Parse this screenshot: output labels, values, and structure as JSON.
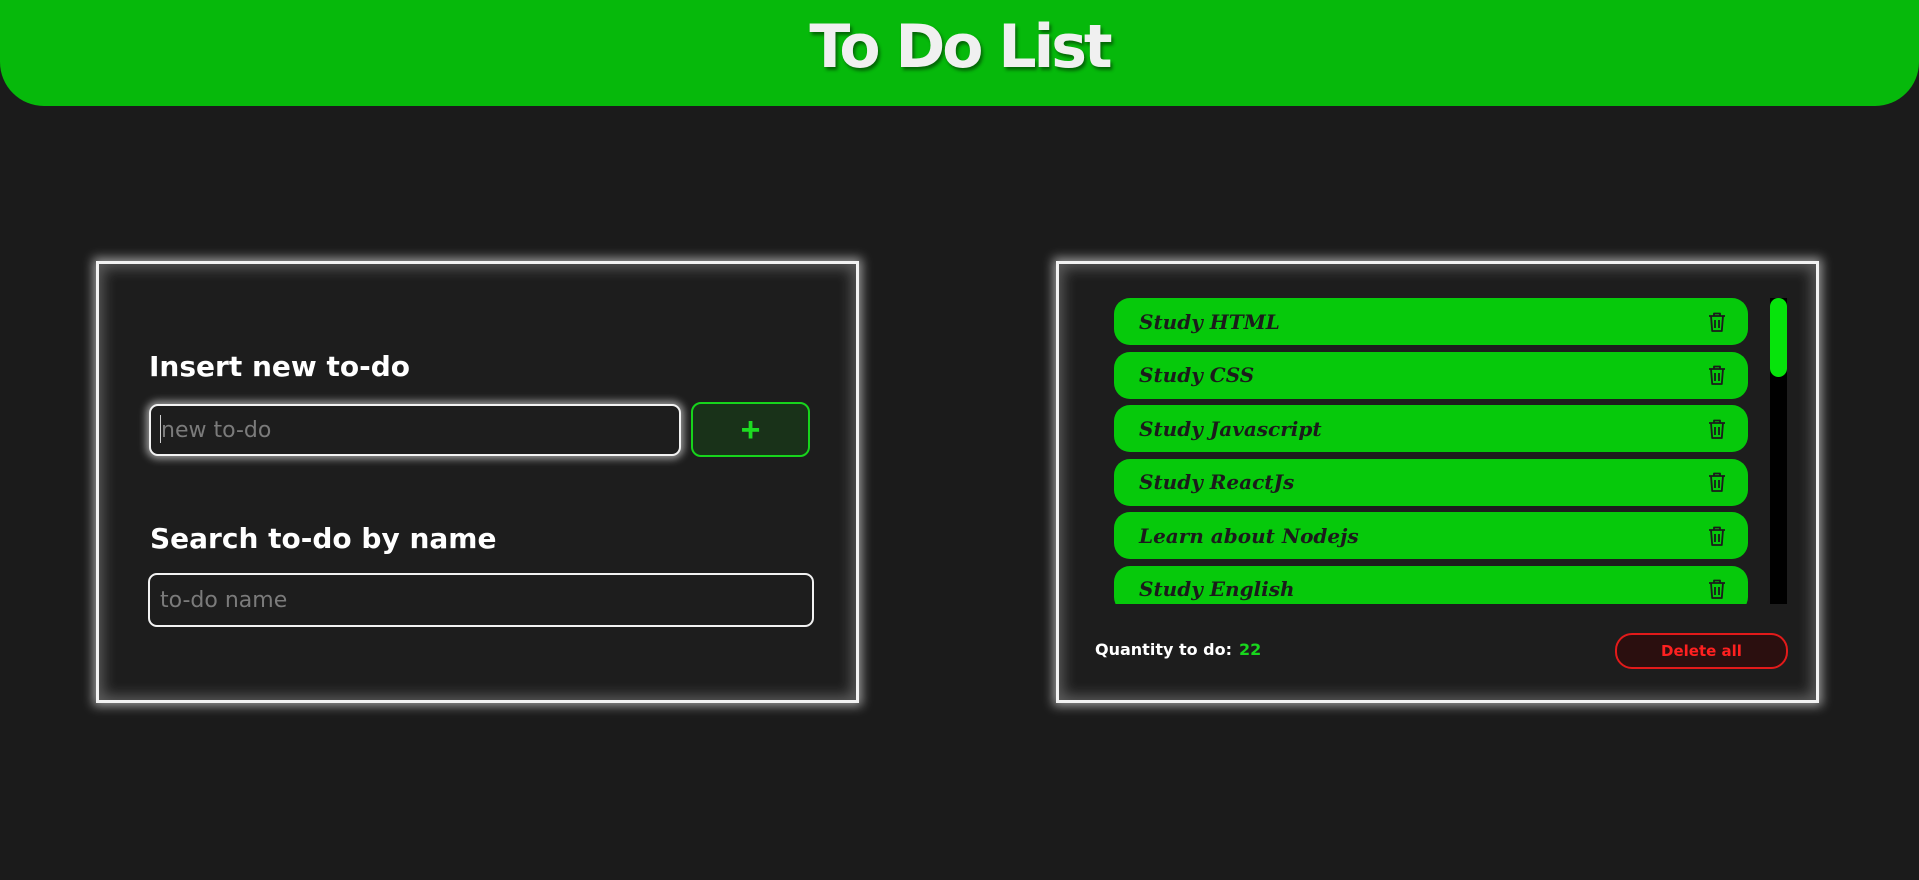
{
  "header": {
    "title": "To Do List"
  },
  "insert": {
    "label": "Insert new to-do",
    "placeholder": "new to-do",
    "value": "",
    "add_icon": "plus-icon",
    "add_symbol": "+"
  },
  "search": {
    "label": "Search to-do by name",
    "placeholder": "to-do name",
    "value": ""
  },
  "todos": {
    "items": [
      {
        "text": "Study HTML",
        "icon": "trash-icon"
      },
      {
        "text": "Study CSS",
        "icon": "trash-icon"
      },
      {
        "text": "Study Javascript",
        "icon": "trash-icon"
      },
      {
        "text": "Study ReactJs",
        "icon": "trash-icon"
      },
      {
        "text": "Learn about Nodejs",
        "icon": "trash-icon"
      },
      {
        "text": "Study English",
        "icon": "trash-icon"
      }
    ],
    "quantity_label": "Quantity to do:",
    "quantity": "22",
    "delete_all_label": "Delete all"
  },
  "colors": {
    "background": "#1b1b1b",
    "header_green": "#06b90b",
    "item_green": "#06c90b",
    "accent_green": "#18d61d",
    "danger_red": "#e21a1a",
    "panel_border": "#f2f2f2"
  }
}
